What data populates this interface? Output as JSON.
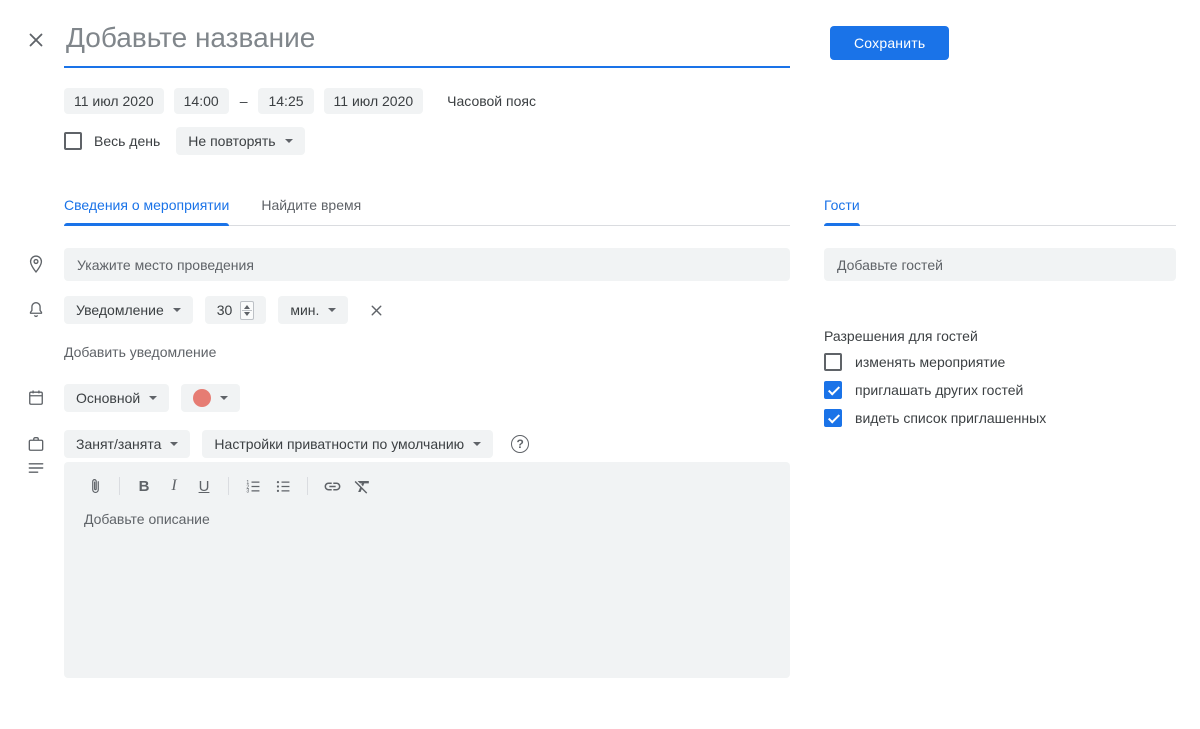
{
  "colors": {
    "accent_blue": "#1a73e8",
    "chip_background": "#f1f3f4",
    "text_primary": "#3c4043",
    "text_secondary": "#5f6368",
    "divider": "#dadce0"
  },
  "header": {
    "title_placeholder": "Добавьте название",
    "save_label": "Сохранить"
  },
  "datetime": {
    "start_date": "11 июл 2020",
    "start_time": "14:00",
    "range_dash": "–",
    "end_time": "14:25",
    "end_date": "11 июл 2020",
    "timezone_label": "Часовой пояс",
    "all_day_label": "Весь день",
    "recurrence_value": "Не повторять"
  },
  "tabs": {
    "event_details": "Сведения о мероприятии",
    "find_time": "Найдите время",
    "guests": "Гости"
  },
  "event_fields": {
    "location_placeholder": "Укажите место проведения",
    "notification": {
      "type_value": "Уведомление",
      "amount_value": "30",
      "unit_value": "мин.",
      "add_link_label": "Добавить уведомление"
    },
    "calendar": {
      "name_value": "Основной",
      "color_value": "#e67c73"
    },
    "availability_value": "Занят/занята",
    "visibility_value": "Настройки приватности по умолчанию",
    "help_glyph": "?",
    "description_placeholder": "Добавьте описание",
    "toolbar": {
      "bold_glyph": "B",
      "italic_glyph": "I",
      "underline_glyph": "U"
    }
  },
  "guests_panel": {
    "input_placeholder": "Добавьте гостей",
    "permissions_title": "Разрешения для гостей",
    "permissions": [
      {
        "label": "изменять мероприятие",
        "checked": false
      },
      {
        "label": "приглашать других гостей",
        "checked": true
      },
      {
        "label": "видеть список приглашенных",
        "checked": true
      }
    ]
  },
  "icons": {
    "close": "close-icon",
    "location": "location-pin-icon",
    "notification": "bell-icon",
    "calendar": "calendar-icon",
    "availability": "briefcase-icon",
    "description": "description-lines-icon",
    "attachment": "paperclip-icon",
    "numbered_list": "numbered-list-icon",
    "bulleted_list": "bulleted-list-icon",
    "link": "link-icon",
    "clear_formatting": "clear-formatting-icon",
    "dropdown_caret": "▾"
  }
}
